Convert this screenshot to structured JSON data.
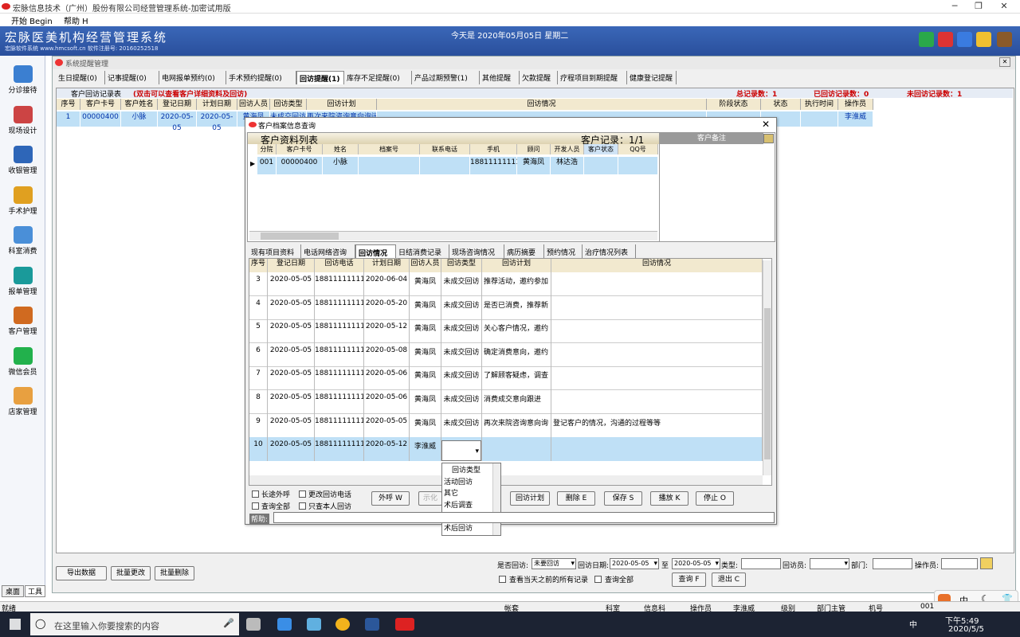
{
  "window": {
    "title": "宏脉信息技术（广州）股份有限公司经营管理系统-加密试用版"
  },
  "menu": {
    "start": "开始 Begin",
    "help": "帮助 H"
  },
  "header": {
    "brand": "宏脉医美机构经营管理系统",
    "sub": "宏脉软件系统  www.hmcsoft.cn  软件注册号: 20160252518",
    "date": "今天是 2020年05月05日  星期二"
  },
  "nav": [
    {
      "label": "分诊接待",
      "icon": "reception-icon",
      "color": "#3b7fd1"
    },
    {
      "label": "现场设计",
      "icon": "design-icon",
      "color": "#c44"
    },
    {
      "label": "收银管理",
      "icon": "cashier-icon",
      "color": "#2e66b8"
    },
    {
      "label": "手术护理",
      "icon": "surgery-icon",
      "color": "#e0a020"
    },
    {
      "label": "科室消费",
      "icon": "department-icon",
      "color": "#4a8fd8"
    },
    {
      "label": "报单管理",
      "icon": "report-icon",
      "color": "#1a9a9a"
    },
    {
      "label": "客户管理",
      "icon": "customer-icon",
      "color": "#d06a20"
    },
    {
      "label": "微信会员",
      "icon": "wechat-icon",
      "color": "#22b14c"
    },
    {
      "label": "店家管理",
      "icon": "store-icon",
      "color": "#e8a040"
    }
  ],
  "navtabs": {
    "desk": "桌面",
    "tools": "工具"
  },
  "panel": {
    "title": "系统提醒管理"
  },
  "reminder_tabs": [
    "生日提醒(0)",
    "记事提醒(0)",
    "电网报单预约(0)",
    "手术预约提醒(0)",
    "回访提醒(1)",
    "库存不足提醒(0)",
    "产品过期预警(1)",
    "其他提醒",
    "欠款提醒",
    "疗程项目到期提醒",
    "健康登记提醒"
  ],
  "grid": {
    "caption": "客户回访记录表",
    "hint": "(双击可以查看客户详细资料及回访)",
    "total": "总记录数：1",
    "done": "已回访记录数：0",
    "undone": "未回访记录数：1",
    "headers": [
      "序号",
      "客户卡号",
      "客户姓名",
      "登记日期",
      "计划日期",
      "回访人员",
      "回访类型",
      "回访计划",
      "回访情况",
      "阶段状态",
      "状态",
      "执行时间",
      "操作员"
    ],
    "row": [
      "1",
      "00000400",
      "小脉",
      "2020-05-05",
      "2020-05-05",
      "黄海凤",
      "未成交回访",
      "再次来院咨询意向询问",
      "",
      "",
      "",
      "",
      "李淮威"
    ]
  },
  "bottom": {
    "export": "导出数据",
    "batch_change": "批量更改",
    "batch_delete": "批量删除",
    "visited_label": "是否回访:",
    "visited_value": "未要回访",
    "visit_date_label": "回访日期:",
    "date_from": "2020-05-05",
    "to": "至",
    "date_to": "2020-05-05",
    "type_label": "类型:",
    "visitor_label": "回访员:",
    "dept_label": "部门:",
    "operator_label": "操作员:",
    "view_prev": "查看当天之前的所有记录",
    "view_all": "查询全部",
    "query": "查询 F",
    "exit": "退出 C"
  },
  "dialog": {
    "title": "客户档案信息查询",
    "list_title": "客户资料列表",
    "record_count": "客户记录：1/1",
    "note_header": "客户备注",
    "cust_headers": [
      "分院",
      "客户卡号",
      "姓名",
      "档案号",
      "联系电话",
      "手机",
      "顾问",
      "开发人员",
      "客户状态",
      "QQ号"
    ],
    "cust_row": [
      "001",
      "00000400",
      "小脉",
      "",
      "",
      "18811111111",
      "黄海凤",
      "林达浩",
      "",
      ""
    ],
    "tabs": [
      "现有项目资料",
      "电话网络咨询",
      "回访情况",
      "日结消费记录",
      "现场咨询情况",
      "病历摘要",
      "预约情况",
      "治疗情况列表"
    ],
    "visit_headers": [
      "序号",
      "登记日期",
      "回访电话",
      "计划日期",
      "回访人员",
      "回访类型",
      "回访计划",
      "回访情况"
    ],
    "visit_rows": [
      [
        "3",
        "2020-05-05",
        "18811111111",
        "2020-06-04",
        "黄海凤",
        "未成交回访",
        "推荐活动，邀约参加",
        ""
      ],
      [
        "4",
        "2020-05-05",
        "18811111111",
        "2020-05-20",
        "黄海凤",
        "未成交回访",
        "是否已消费，推荐新",
        ""
      ],
      [
        "5",
        "2020-05-05",
        "18811111111",
        "2020-05-12",
        "黄海凤",
        "未成交回访",
        "关心客户情况，邀约",
        ""
      ],
      [
        "6",
        "2020-05-05",
        "18811111111",
        "2020-05-08",
        "黄海凤",
        "未成交回访",
        "确定消费意向，邀约",
        ""
      ],
      [
        "7",
        "2020-05-05",
        "18811111111",
        "2020-05-06",
        "黄海凤",
        "未成交回访",
        "了解顾客疑虑，调查",
        ""
      ],
      [
        "8",
        "2020-05-05",
        "18811111111",
        "2020-05-06",
        "黄海凤",
        "未成交回访",
        "消费成交意向跟进",
        ""
      ],
      [
        "9",
        "2020-05-05",
        "18811111111",
        "2020-05-05",
        "黄海凤",
        "未成交回访",
        "再次来院咨询意向询",
        "登记客户的情况，沟通的过程等等"
      ],
      [
        "10",
        "2020-05-05",
        "18811111111",
        "2020-05-12",
        "李淮威",
        "",
        "",
        ""
      ]
    ],
    "dropdown": [
      "回访类型",
      "活动回访",
      "其它",
      "术后调查",
      "术后复查",
      "术后回访"
    ],
    "checks": [
      "长途外呼",
      "更改回访电话",
      "查询全部",
      "只查本人回访"
    ],
    "buttons": [
      "外呼 W",
      "示化",
      "回访计划",
      "删除 E",
      "保存 S",
      "播放 K",
      "停止 O"
    ],
    "help_label": "帮助:"
  },
  "statusbar": {
    "left": "就绪",
    "items": [
      "帐套",
      "科室",
      "信息科",
      "操作员",
      "李淮威",
      "级别",
      "部门主管",
      "机号",
      "001"
    ]
  },
  "taskbar": {
    "search": "在这里输入你要搜索的内容",
    "time": "下午5:49",
    "date": "2020/5/5",
    "ime": "中"
  }
}
